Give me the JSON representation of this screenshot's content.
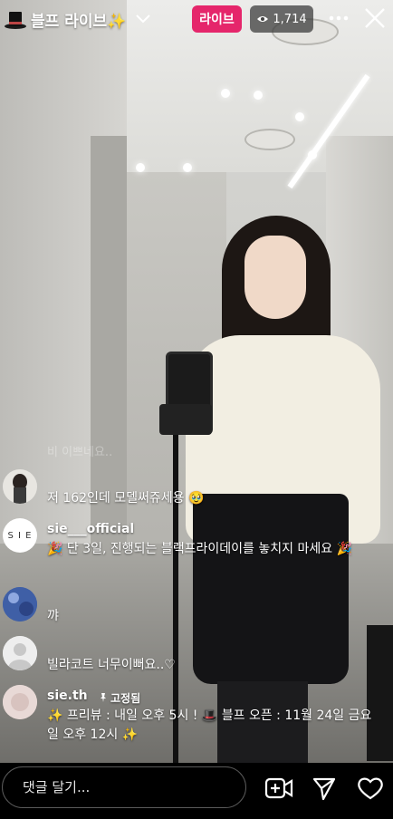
{
  "header": {
    "hat_emoji": "🎩",
    "account_title": "블프 라이브✨",
    "live_label": "라이브",
    "viewer_count": "1,714"
  },
  "faded_comment": "비 이쁘네요..",
  "comments": [
    {
      "user": "",
      "text": "저 162인데 모델써쥬세용 🥹",
      "avatar_color": "#cfcfcf"
    },
    {
      "user": "sie___official",
      "text": "🎉 단 3일, 진행되는 블랙프라이데이를 놓치지 마세요 🎉",
      "avatar_label": "S I E"
    },
    {
      "user": "",
      "text": "꺄",
      "avatar_color": "#3f5fa6"
    },
    {
      "user": "",
      "text": "빌라코트 너무이뻐요..♡",
      "avatar_color": "#f4f4f4"
    },
    {
      "user": "sie.th",
      "pinned_label": "고정됨",
      "text": "✨ 프리뷰 : 내일 오후 5시 ! 🎩 블프 오픈 : 11월 24일 금요일 오후 12시 ✨",
      "avatar_color": "#e8d9d6"
    }
  ],
  "footer": {
    "comment_placeholder": "댓글 달기..."
  },
  "colors": {
    "live_badge": "#e5266b",
    "viewer_pill": "#3c3c3c"
  }
}
